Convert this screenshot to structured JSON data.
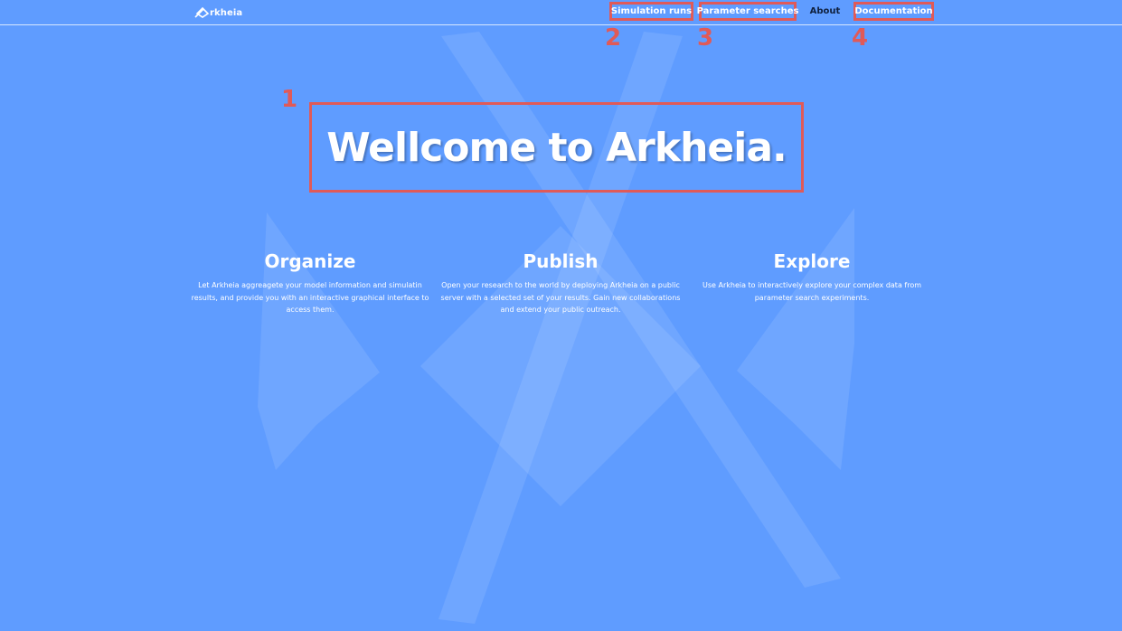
{
  "colors": {
    "background": "#5f9cff",
    "annotation": "#e05a58",
    "text": "#ffffff",
    "active_nav": "#10213f"
  },
  "brand": {
    "name": "rkheia",
    "icon": "arkheia-logo-icon"
  },
  "nav": {
    "items": [
      {
        "label": "Simulation runs",
        "annotation": "2"
      },
      {
        "label": "Parameter searches",
        "annotation": "3"
      },
      {
        "label": "About",
        "active": true
      },
      {
        "label": "Documentation",
        "annotation": "4"
      }
    ]
  },
  "hero": {
    "title": "Wellcome to Arkheia.",
    "annotation": "1"
  },
  "features": [
    {
      "title": "Organize",
      "text": "Let Arkheia aggreagete your model information and simulatin results, and provide you with an interactive graphical interface to access them."
    },
    {
      "title": "Publish",
      "text": "Open your research to the world by deploying Arkheia on a public server with a selected set of your results. Gain new collaborations and extend your public outreach."
    },
    {
      "title": "Explore",
      "text": "Use Arkheia to interactively explore your complex data from parameter search experiments."
    }
  ]
}
